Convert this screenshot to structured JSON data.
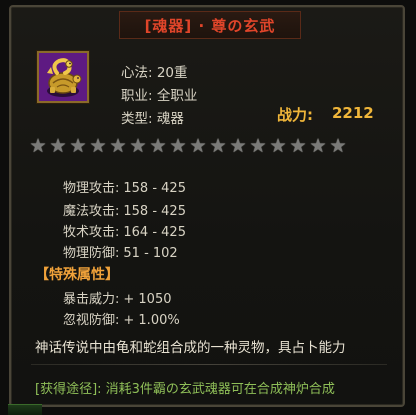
{
  "tooltip": {
    "title": "[魂器] · 尊の玄武",
    "icon": "golden-tortoise-snake-icon",
    "info": {
      "level": "心法: 20重",
      "profession": "职业: 全职业",
      "type": "类型: 魂器"
    },
    "power": {
      "label": "战力:",
      "value": "2212"
    },
    "stars": {
      "count": 16,
      "filled": 0
    },
    "stats": [
      {
        "label": "物理攻击:",
        "value": "158 - 425"
      },
      {
        "label": "魔法攻击:",
        "value": "158 - 425"
      },
      {
        "label": "牧术攻击:",
        "value": "164 - 425"
      },
      {
        "label": "物理防御:",
        "value": "51 - 102"
      }
    ],
    "special": {
      "header": "【特殊属性】",
      "items": [
        {
          "label": "暴击威力:",
          "value": "+ 1050"
        },
        {
          "label": "忽视防御:",
          "value": "+ 1.00%"
        }
      ]
    },
    "description": "神话传说中由龟和蛇组合成的一种灵物，具占卜能力",
    "obtain": "[获得途径]: 消耗3件霸の玄武魂器可在合成神炉合成",
    "colors": {
      "title": "#e0452a",
      "power": "#f0b63a",
      "special_header": "#f0a23a",
      "obtain": "#8fbf58",
      "text": "#d8d3c4"
    }
  }
}
